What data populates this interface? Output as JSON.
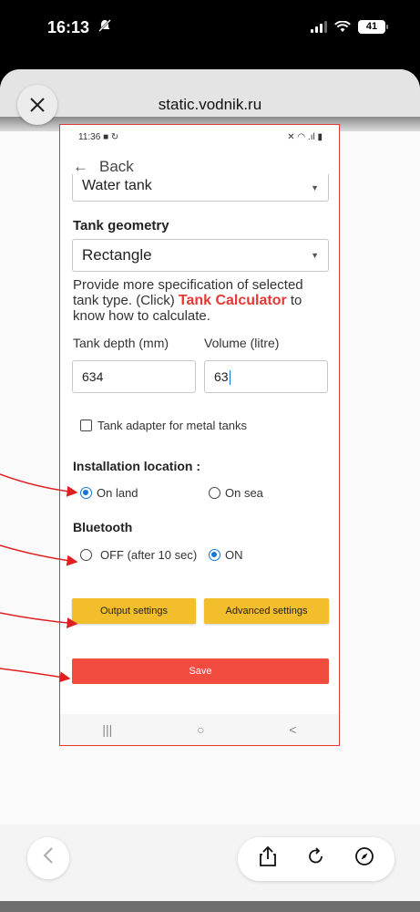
{
  "ios_status": {
    "time": "16:13",
    "battery": "41"
  },
  "browser": {
    "url": "static.vodnik.ru"
  },
  "app": {
    "status_time": "11:36",
    "back_label": "Back",
    "tank_type_value": "Water tank",
    "geometry_heading": "Tank geometry",
    "geometry_value": "Rectangle",
    "description_before": "Provide more specification of selected tank type. (Click) ",
    "description_link": "Tank Calculator",
    "description_after": " to know how to calculate.",
    "depth_label": "Tank depth (mm)",
    "depth_value": "634",
    "volume_label": "Volume (litre)",
    "volume_value": "63",
    "adapter_label": "Tank adapter for metal tanks",
    "location_heading": "Installation location :",
    "location_options": [
      "On land",
      "On sea"
    ],
    "location_selected": "On land",
    "bluetooth_heading": "Bluetooth",
    "bluetooth_options": [
      "OFF (after 10 sec)",
      "ON"
    ],
    "bluetooth_selected": "ON",
    "output_settings_label": "Output settings",
    "advanced_settings_label": "Advanced settings",
    "save_label": "Save"
  },
  "colors": {
    "accent_red": "#e53935",
    "radio_blue": "#1976d2",
    "button_yellow": "#f3be2b",
    "save_red": "#f14c3f"
  }
}
